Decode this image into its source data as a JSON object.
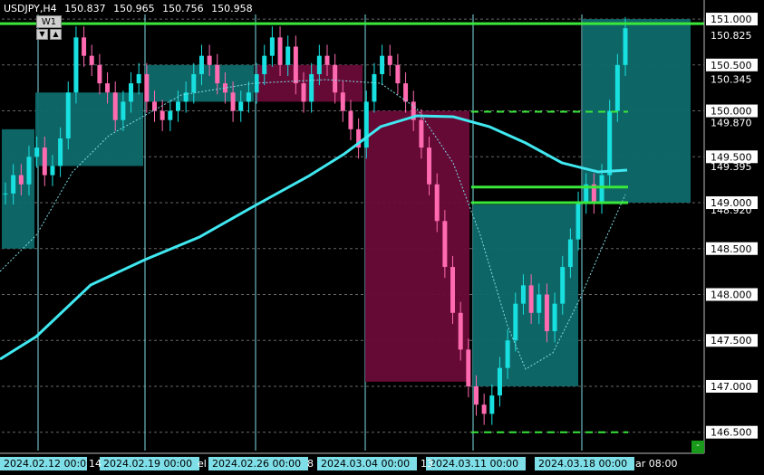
{
  "header": {
    "symbol": "USDJPY,H4",
    "open": "150.837",
    "high": "150.965",
    "low": "150.756",
    "close": "150.958"
  },
  "timeframe_button": {
    "label": "W1",
    "down_arrow": "▼",
    "up_arrow": "▲"
  },
  "corner_button": {
    "label": "-"
  },
  "colors": {
    "background": "#000000",
    "bull": "#18e0e0",
    "bear": "#ff6ab0",
    "zone_bull": "#0f6a6a",
    "zone_bear": "#6a0a38",
    "ma_thick": "#40e8f0",
    "level_green": "#39e83a",
    "price_label_bg": "#ffffff"
  },
  "chart_data": {
    "type": "candlestick",
    "symbol": "USDJPY",
    "timeframe": "H4",
    "y_axis": {
      "min": 146.3,
      "max": 151.05,
      "tick_labels": [
        "151.000",
        "150.825",
        "150.500",
        "150.345",
        "150.000",
        "149.870",
        "149.500",
        "149.395",
        "149.000",
        "148.920",
        "148.500",
        "148.000",
        "147.500",
        "147.000",
        "146.500"
      ],
      "bold_labels": [
        "151.000",
        "150.500",
        "150.000",
        "149.500",
        "149.000",
        "148.500",
        "148.000",
        "147.500",
        "147.000",
        "146.500"
      ]
    },
    "x_axis": {
      "tick_labels": [
        "2024.02.12 00:05",
        "2024.02.19 00:00",
        "2024.02.26 00:00",
        "2024.03.04 00:00",
        "2024.03.11 00:00",
        "2024.03.18 00:00"
      ],
      "partial_labels": [
        "14",
        "el",
        "8",
        "13",
        "ar 08:00"
      ]
    },
    "ohlc_close_path": [
      149.1,
      149.3,
      149.2,
      149.5,
      149.6,
      149.3,
      149.4,
      149.7,
      150.2,
      150.8,
      150.6,
      150.5,
      150.3,
      150.2,
      149.9,
      150.1,
      150.3,
      150.4,
      150.1,
      150.0,
      149.9,
      150.0,
      150.1,
      150.2,
      150.4,
      150.6,
      150.5,
      150.3,
      150.2,
      150.0,
      150.1,
      150.2,
      150.4,
      150.6,
      150.8,
      150.5,
      150.7,
      150.3,
      150.1,
      150.4,
      150.6,
      150.5,
      150.2,
      150.0,
      149.8,
      149.6,
      150.1,
      150.4,
      150.6,
      150.5,
      150.3,
      150.1,
      149.9,
      149.6,
      149.2,
      148.8,
      148.3,
      147.8,
      147.4,
      147.0,
      146.8,
      146.7,
      146.9,
      147.2,
      147.5,
      147.9,
      148.1,
      147.8,
      148.0,
      147.6,
      147.9,
      148.3,
      148.6,
      149.0,
      149.2,
      149.0,
      149.3,
      150.0,
      150.5,
      150.9
    ]
  },
  "zones": [
    {
      "kind": "bull",
      "from": 149.8,
      "to": 148.5
    },
    {
      "kind": "bull",
      "from": 150.2,
      "to": 149.4
    },
    {
      "kind": "bull",
      "from": 150.5,
      "to": 150.1
    },
    {
      "kind": "bear",
      "from": 150.5,
      "to": 150.1
    },
    {
      "kind": "bear",
      "from": 150.0,
      "to": 147.05
    },
    {
      "kind": "bull",
      "from": 148.98,
      "to": 147.0
    },
    {
      "kind": "bull",
      "from": 151.0,
      "to": 149.0
    }
  ],
  "levels": [
    {
      "price": 150.95,
      "style": "solid"
    },
    {
      "price": 149.99,
      "style": "dashed"
    },
    {
      "price": 149.17,
      "style": "solid"
    },
    {
      "price": 149.0,
      "style": "solid"
    },
    {
      "price": 146.5,
      "style": "dashed"
    }
  ]
}
